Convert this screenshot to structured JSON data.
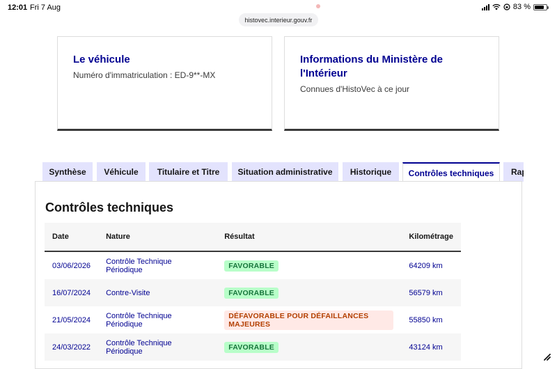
{
  "status_bar": {
    "time": "12:01",
    "date": "Fri 7 Aug",
    "battery_pct": "83 %",
    "battery_level": 0.83
  },
  "browser": {
    "url": "histovec.interieur.gouv.fr"
  },
  "cards": [
    {
      "title": "Le véhicule",
      "desc": "Numéro d'immatriculation : ED-9**-MX"
    },
    {
      "title": "Informations du Ministère de l'Intérieur",
      "desc": "Connues d'HistoVec à ce jour"
    }
  ],
  "tabs": [
    {
      "label": "Synthèse",
      "active": false
    },
    {
      "label": "Véhicule",
      "active": false
    },
    {
      "label": "Titulaire et Titre",
      "active": false
    },
    {
      "label": "Situation administrative",
      "active": false
    },
    {
      "label": "Historique",
      "active": false
    },
    {
      "label": "Contrôles techniques",
      "active": true
    },
    {
      "label": "Rap",
      "active": false
    }
  ],
  "panel": {
    "title": "Contrôles techniques",
    "table": {
      "headers": [
        "Date",
        "Nature",
        "Résultat",
        "Kilométrage"
      ],
      "rows": [
        {
          "date": "03/06/2026",
          "nature": "Contrôle Technique Périodique",
          "result": "FAVORABLE",
          "result_type": "ok",
          "km": "64209 km"
        },
        {
          "date": "16/07/2024",
          "nature": "Contre-Visite",
          "result": "FAVORABLE",
          "result_type": "ok",
          "km": "56579 km"
        },
        {
          "date": "21/05/2024",
          "nature": "Contrôle Technique Périodique",
          "result": "DÉFAVORABLE POUR DÉFAILLANCES MAJEURES",
          "result_type": "ko",
          "km": "55850 km"
        },
        {
          "date": "24/03/2022",
          "nature": "Contrôle Technique Périodique",
          "result": "FAVORABLE",
          "result_type": "ok",
          "km": "43124 km"
        }
      ]
    }
  },
  "colors": {
    "primary": "#000091",
    "tab_bg": "#e3e3fd",
    "ok_bg": "#b8fec9",
    "ok_text": "#18753c",
    "ko_bg": "#ffe9e6",
    "ko_text": "#b34000"
  }
}
